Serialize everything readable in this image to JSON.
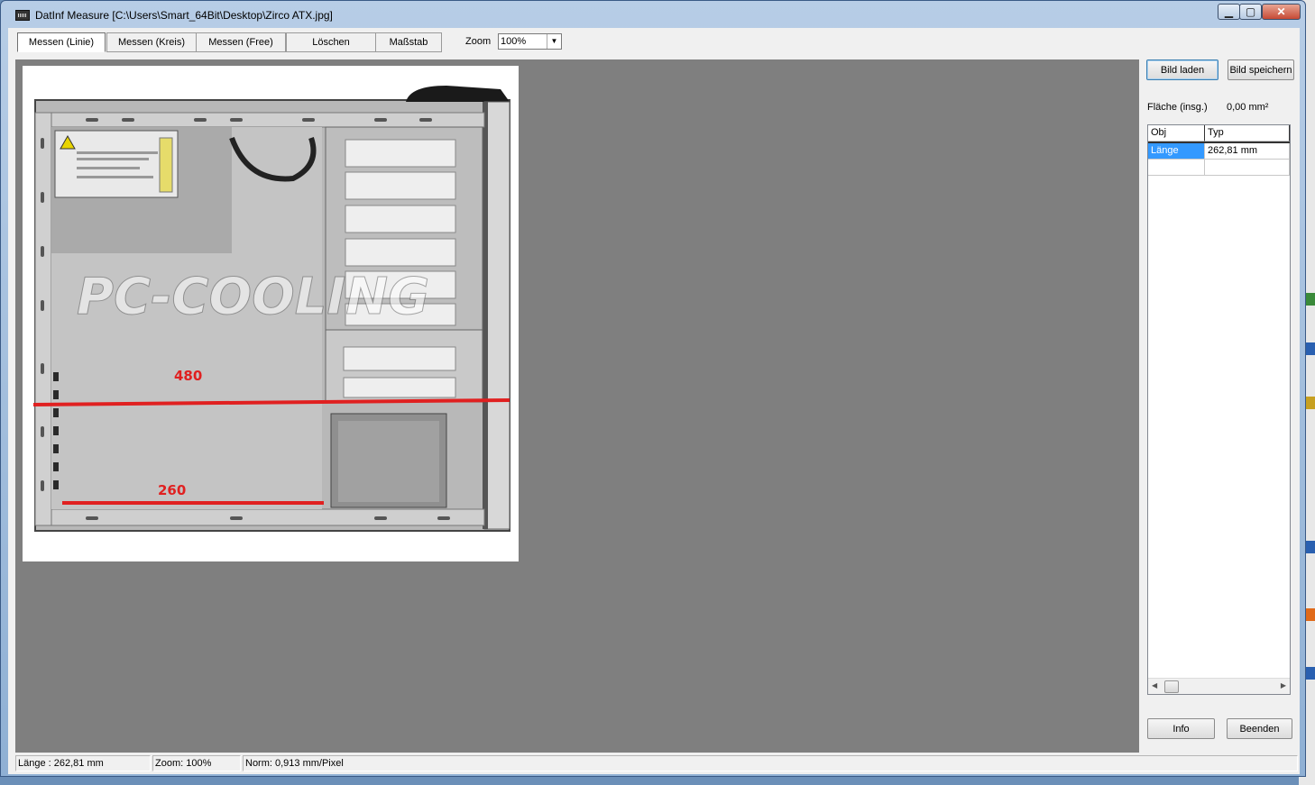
{
  "window": {
    "title": "DatInf Measure [C:\\Users\\Smart_64Bit\\Desktop\\Zirco ATX.jpg]",
    "controls": {
      "minimize": "▁",
      "maximize": "▢",
      "close": "✕"
    }
  },
  "toolbar": {
    "tabs": [
      {
        "label": "Messen (Linie)",
        "active": true
      },
      {
        "label": "Messen (Kreis)",
        "active": false
      },
      {
        "label": "Messen (Free)",
        "active": false
      },
      {
        "label": "Löschen",
        "active": false
      },
      {
        "label": "Maßstab",
        "active": false
      }
    ],
    "zoom_label": "Zoom",
    "zoom_value": "100%"
  },
  "image": {
    "watermark": "PC-COOLING",
    "annotations": [
      {
        "label": "480"
      },
      {
        "label": "260"
      }
    ],
    "annotation_color": "#e02020",
    "psu_label": "Power Supply"
  },
  "panel": {
    "load_button": "Bild laden",
    "save_button": "Bild speichern",
    "area_label": "Fläche (insg.)",
    "area_value": "0,00 mm²",
    "table": {
      "headers": [
        "Obj",
        "Typ"
      ],
      "rows": [
        {
          "obj": "Länge",
          "typ": "262,81 mm",
          "selected": true
        },
        {
          "obj": "",
          "typ": "",
          "selected": false
        }
      ]
    },
    "info_button": "Info",
    "exit_button": "Beenden"
  },
  "statusbar": {
    "length": "Länge : 262,81 mm",
    "zoom": "Zoom: 100%",
    "norm": "Norm: 0,913 mm/Pixel"
  },
  "colors": {
    "canvas": "#7f7f7f",
    "selection": "#3399ff",
    "title_bar": "#b7cde6"
  }
}
